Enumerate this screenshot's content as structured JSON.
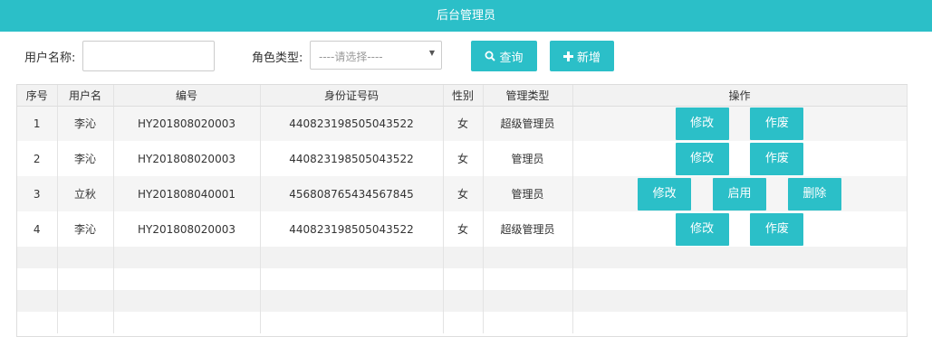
{
  "header": {
    "title": "后台管理员"
  },
  "filter": {
    "username_label": "用户名称:",
    "username_value": "",
    "role_label": "角色类型:",
    "role_placeholder": "----请选择----",
    "search_label": "查询",
    "add_label": "新增"
  },
  "table": {
    "columns": [
      "序号",
      "用户名",
      "编号",
      "身份证号码",
      "性别",
      "管理类型",
      "操作"
    ],
    "rows": [
      {
        "index": "1",
        "username": "李沁",
        "code": "HY201808020003",
        "id_number": "440823198505043522",
        "gender": "女",
        "role": "超级管理员",
        "actions": [
          "修改",
          "作废"
        ]
      },
      {
        "index": "2",
        "username": "李沁",
        "code": "HY201808020003",
        "id_number": "440823198505043522",
        "gender": "女",
        "role": "管理员",
        "actions": [
          "修改",
          "作废"
        ]
      },
      {
        "index": "3",
        "username": "立秋",
        "code": "HY201808040001",
        "id_number": "456808765434567845",
        "gender": "女",
        "role": "管理员",
        "actions": [
          "修改",
          "启用",
          "删除"
        ]
      },
      {
        "index": "4",
        "username": "李沁",
        "code": "HY201808020003",
        "id_number": "440823198505043522",
        "gender": "女",
        "role": "超级管理员",
        "actions": [
          "修改",
          "作废"
        ]
      }
    ]
  },
  "colors": {
    "accent": "#2bbfc8"
  }
}
